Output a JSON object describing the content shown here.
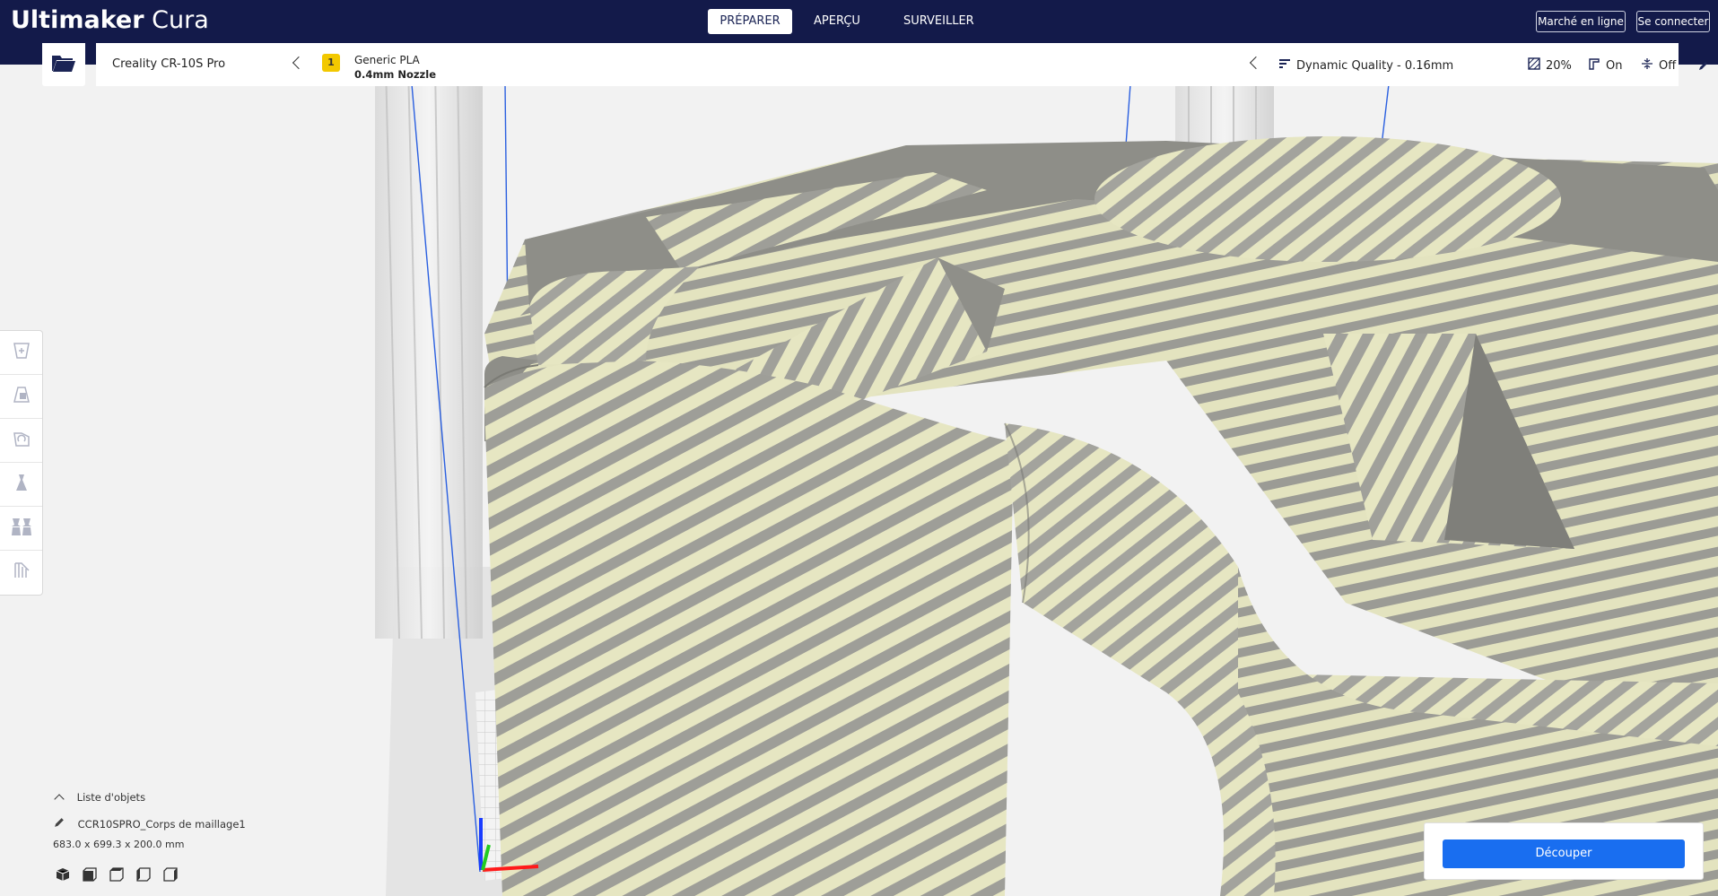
{
  "app": {
    "logo_brand": "Ultimaker",
    "logo_product": "Cura"
  },
  "header": {
    "stages": [
      "PRÉPARER",
      "APERÇU",
      "SURVEILLER"
    ],
    "active_stage": "PRÉPARER",
    "marketplace_label": "Marché en ligne",
    "signin_label": "Se connecter"
  },
  "printer": {
    "name": "Creality CR-10S Pro"
  },
  "material": {
    "extruder_number": "1",
    "material_name": "Generic PLA",
    "nozzle": "0.4mm Nozzle"
  },
  "print_settings": {
    "profile": "Dynamic Quality - 0.16mm",
    "infill": "20%",
    "support": "On",
    "adhesion": "Off"
  },
  "object_list": {
    "header": "Liste d'objets",
    "object_name": "CCR10SPRO_Corps de maillage1",
    "dimensions": "683.0 x 699.3 x 200.0 mm"
  },
  "action": {
    "slice_label": "Découper"
  },
  "colors": {
    "header_bg": "#131a4a",
    "accent_blue": "#196ef0",
    "extruder_badge": "#f2c800",
    "model_light": "#e6e6c2",
    "model_dark": "#9e9e98"
  },
  "icons": {
    "open_file": "folder-open-icon",
    "toolbar": [
      "move-tool-icon",
      "scale-tool-icon",
      "rotate-tool-icon",
      "mirror-tool-icon",
      "per-model-settings-icon",
      "support-blocker-icon"
    ],
    "views": [
      "3d-view-icon",
      "front-view-icon",
      "top-view-icon",
      "left-view-icon",
      "right-view-icon"
    ]
  }
}
